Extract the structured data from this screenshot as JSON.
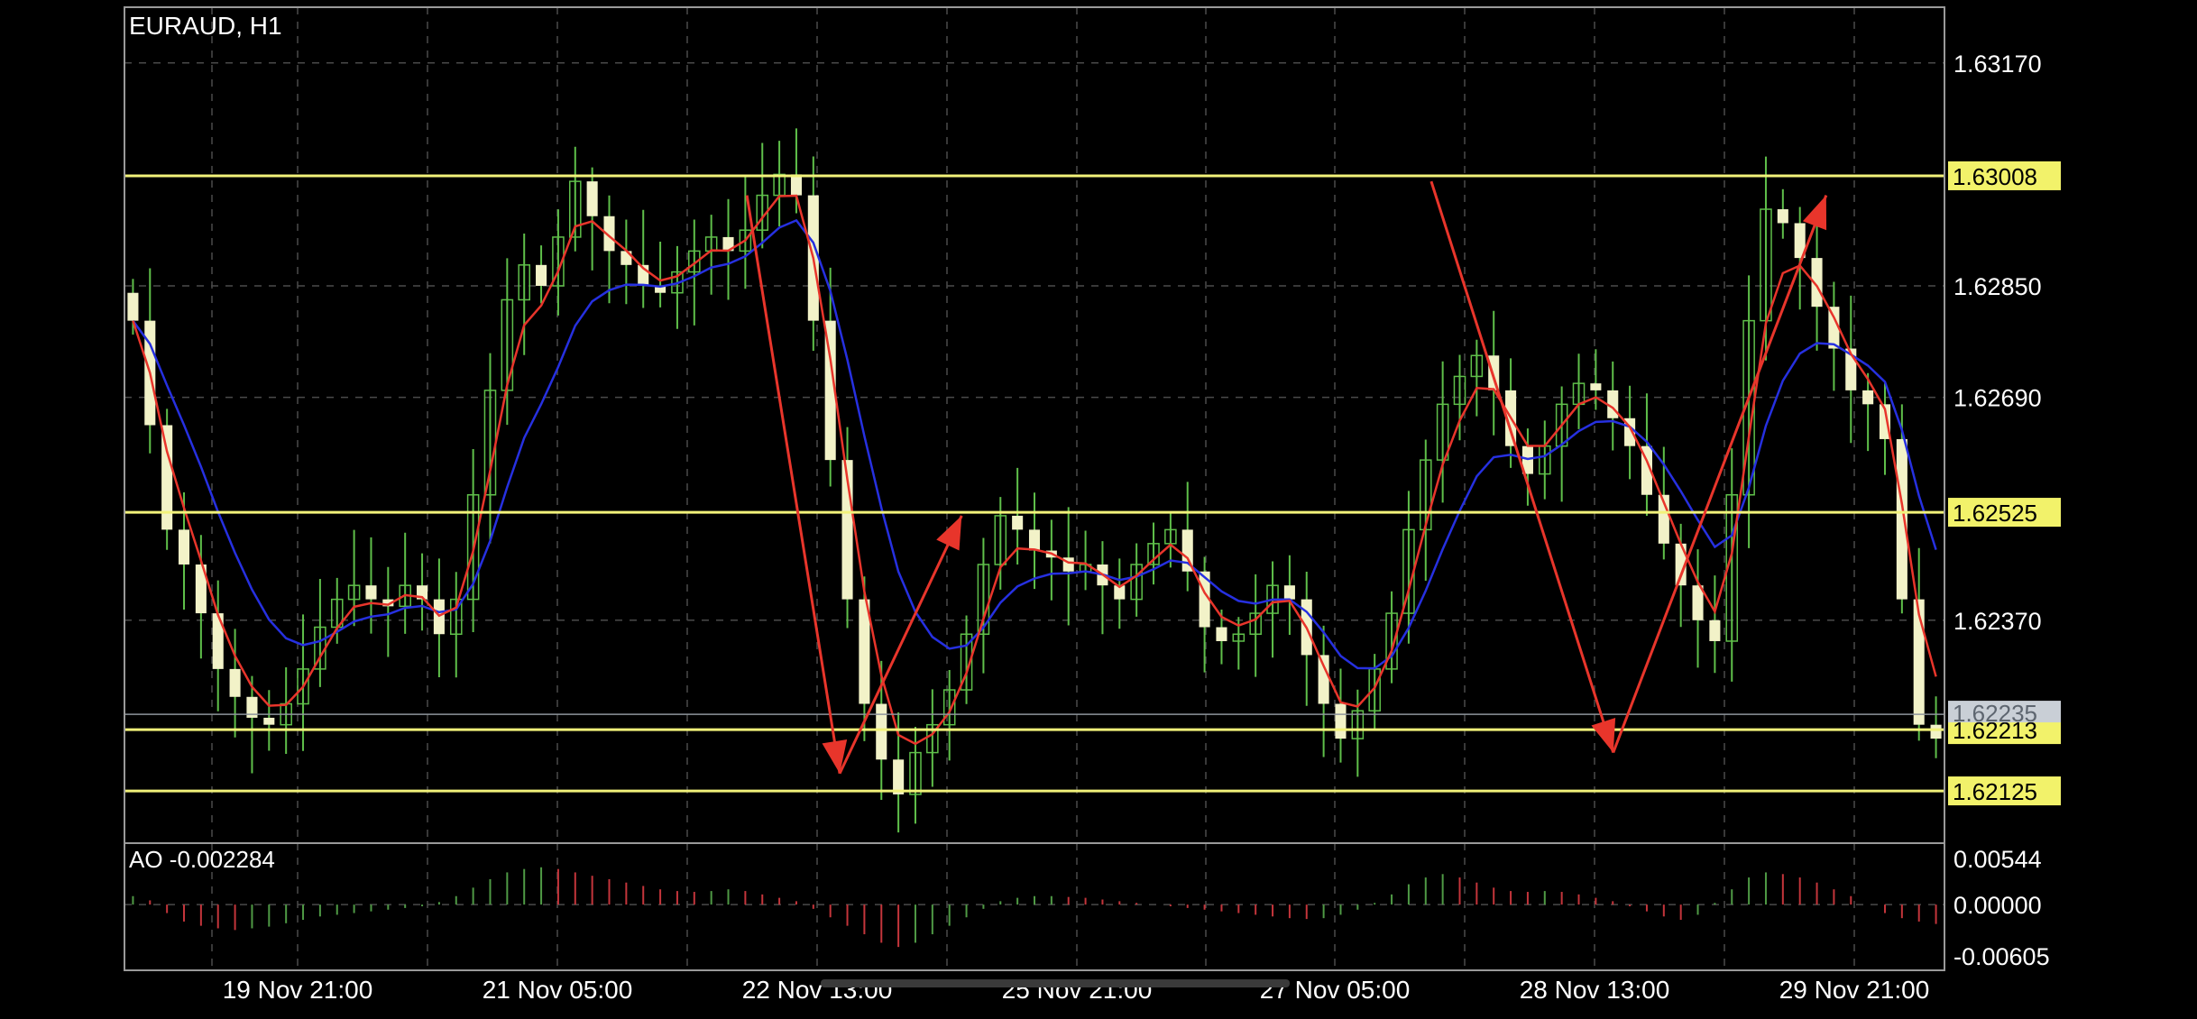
{
  "chart_data": [
    {
      "type": "candlestick",
      "title": "EURAUD, H1",
      "symbol": "EURAUD",
      "timeframe": "H1",
      "price_axis": {
        "ylim": [
          1.6205,
          1.6325
        ],
        "ticks": [
          "1.63170",
          "1.62850",
          "1.62690",
          "1.62370"
        ],
        "current_price_label": "1.62235"
      },
      "x_labels": [
        "19 Nov 21:00",
        "21 Nov 05:00",
        "22 Nov 13:00",
        "25 Nov 21:00",
        "27 Nov 05:00",
        "28 Nov 13:00",
        "29 Nov 21:00"
      ],
      "levels": [
        {
          "value": 1.63008,
          "label": "1.63008"
        },
        {
          "value": 1.62525,
          "label": "1.62525"
        },
        {
          "value": 1.62213,
          "label": "1.62213"
        },
        {
          "value": 1.62125,
          "label": "1.62125"
        }
      ],
      "close_path": [
        1.628,
        1.6265,
        1.625,
        1.6245,
        1.6238,
        1.623,
        1.6226,
        1.6223,
        1.6222,
        1.6225,
        1.623,
        1.6236,
        1.624,
        1.6242,
        1.624,
        1.6239,
        1.6242,
        1.624,
        1.6235,
        1.624,
        1.6255,
        1.627,
        1.6283,
        1.6288,
        1.6285,
        1.6292,
        1.63,
        1.6295,
        1.629,
        1.6288,
        1.6285,
        1.6284,
        1.6287,
        1.629,
        1.6292,
        1.629,
        1.6293,
        1.6298,
        1.6301,
        1.6298,
        1.628,
        1.626,
        1.624,
        1.6225,
        1.6217,
        1.6212,
        1.6218,
        1.6222,
        1.6227,
        1.6235,
        1.6245,
        1.6252,
        1.625,
        1.6247,
        1.6246,
        1.6244,
        1.6245,
        1.6242,
        1.624,
        1.6245,
        1.6248,
        1.625,
        1.6244,
        1.6236,
        1.6234,
        1.6235,
        1.6238,
        1.6242,
        1.624,
        1.6232,
        1.6225,
        1.622,
        1.6224,
        1.623,
        1.6238,
        1.625,
        1.626,
        1.6268,
        1.6272,
        1.6275,
        1.627,
        1.6262,
        1.6258,
        1.6262,
        1.6268,
        1.6271,
        1.627,
        1.6266,
        1.6262,
        1.6255,
        1.6248,
        1.6242,
        1.6237,
        1.6234,
        1.6255,
        1.628,
        1.6296,
        1.6294,
        1.6289,
        1.6282,
        1.6276,
        1.627,
        1.6268,
        1.6263,
        1.624,
        1.6222,
        1.622
      ],
      "annotations": [
        {
          "type": "arrow",
          "from": [
            0.342,
            1.6298
          ],
          "to": [
            0.393,
            1.6215
          ],
          "color": "#e8352b"
        },
        {
          "type": "arrow",
          "from": [
            0.393,
            1.6215
          ],
          "to": [
            0.46,
            1.6252
          ],
          "color": "#e8352b"
        },
        {
          "type": "arrow",
          "from": [
            0.718,
            1.63
          ],
          "to": [
            0.818,
            1.6218
          ],
          "color": "#e8352b"
        },
        {
          "type": "arrow",
          "from": [
            0.818,
            1.6218
          ],
          "to": [
            0.935,
            1.6298
          ],
          "color": "#e8352b"
        }
      ]
    },
    {
      "type": "bar",
      "title": "AO -0.002284",
      "indicator": "AO",
      "value_label": "-0.002284",
      "ylim": [
        -0.00605,
        0.00544
      ],
      "ticks": [
        "0.00544",
        "0.00000",
        "-0.00605"
      ],
      "ao_path": [
        0.001,
        0.0005,
        -0.001,
        -0.002,
        -0.0025,
        -0.0028,
        -0.003,
        -0.0028,
        -0.0026,
        -0.0022,
        -0.0018,
        -0.0014,
        -0.0012,
        -0.001,
        -0.0008,
        -0.0006,
        -0.0004,
        -0.0002,
        0.0003,
        0.001,
        0.002,
        0.003,
        0.0038,
        0.0042,
        0.0044,
        0.0042,
        0.0038,
        0.0034,
        0.003,
        0.0026,
        0.0022,
        0.0018,
        0.0016,
        0.0015,
        0.0016,
        0.0018,
        0.0016,
        0.0012,
        0.0008,
        0.0004,
        -0.0005,
        -0.0015,
        -0.0025,
        -0.0035,
        -0.0045,
        -0.005,
        -0.0045,
        -0.0035,
        -0.0025,
        -0.0015,
        -0.0005,
        0.0004,
        0.0008,
        0.001,
        0.001,
        0.0009,
        0.0008,
        0.0006,
        0.0004,
        0.0002,
        0.0,
        -0.0002,
        -0.0004,
        -0.0006,
        -0.0008,
        -0.001,
        -0.0012,
        -0.0014,
        -0.0016,
        -0.0017,
        -0.0016,
        -0.0012,
        -0.0006,
        0.0002,
        0.0012,
        0.0024,
        0.0032,
        0.0036,
        0.0032,
        0.0026,
        0.002,
        0.0016,
        0.0015,
        0.0016,
        0.0015,
        0.0012,
        0.0008,
        0.0004,
        -0.0002,
        -0.0008,
        -0.0014,
        -0.0018,
        -0.0012,
        0.0002,
        0.0018,
        0.0032,
        0.0038,
        0.0036,
        0.0032,
        0.0026,
        0.0018,
        0.001,
        0.0,
        -0.001,
        -0.0016,
        -0.002,
        -0.002284
      ]
    }
  ],
  "colors": {
    "background": "#000000",
    "grid": "#4a4a4a",
    "frame": "#9a9a9a",
    "candle_bull_wick": "#5fbf4a",
    "candle_body": "#f2f2c8",
    "ma_fast": "#e8352b",
    "ma_slow": "#2630e0",
    "level_line": "#f2f27a",
    "level_label_bg": "#f2f26a",
    "current_label_bg": "#c9cfd6",
    "ao_up": "#4f9a45",
    "ao_down": "#c4353b",
    "axis_text": "#ffffff"
  }
}
